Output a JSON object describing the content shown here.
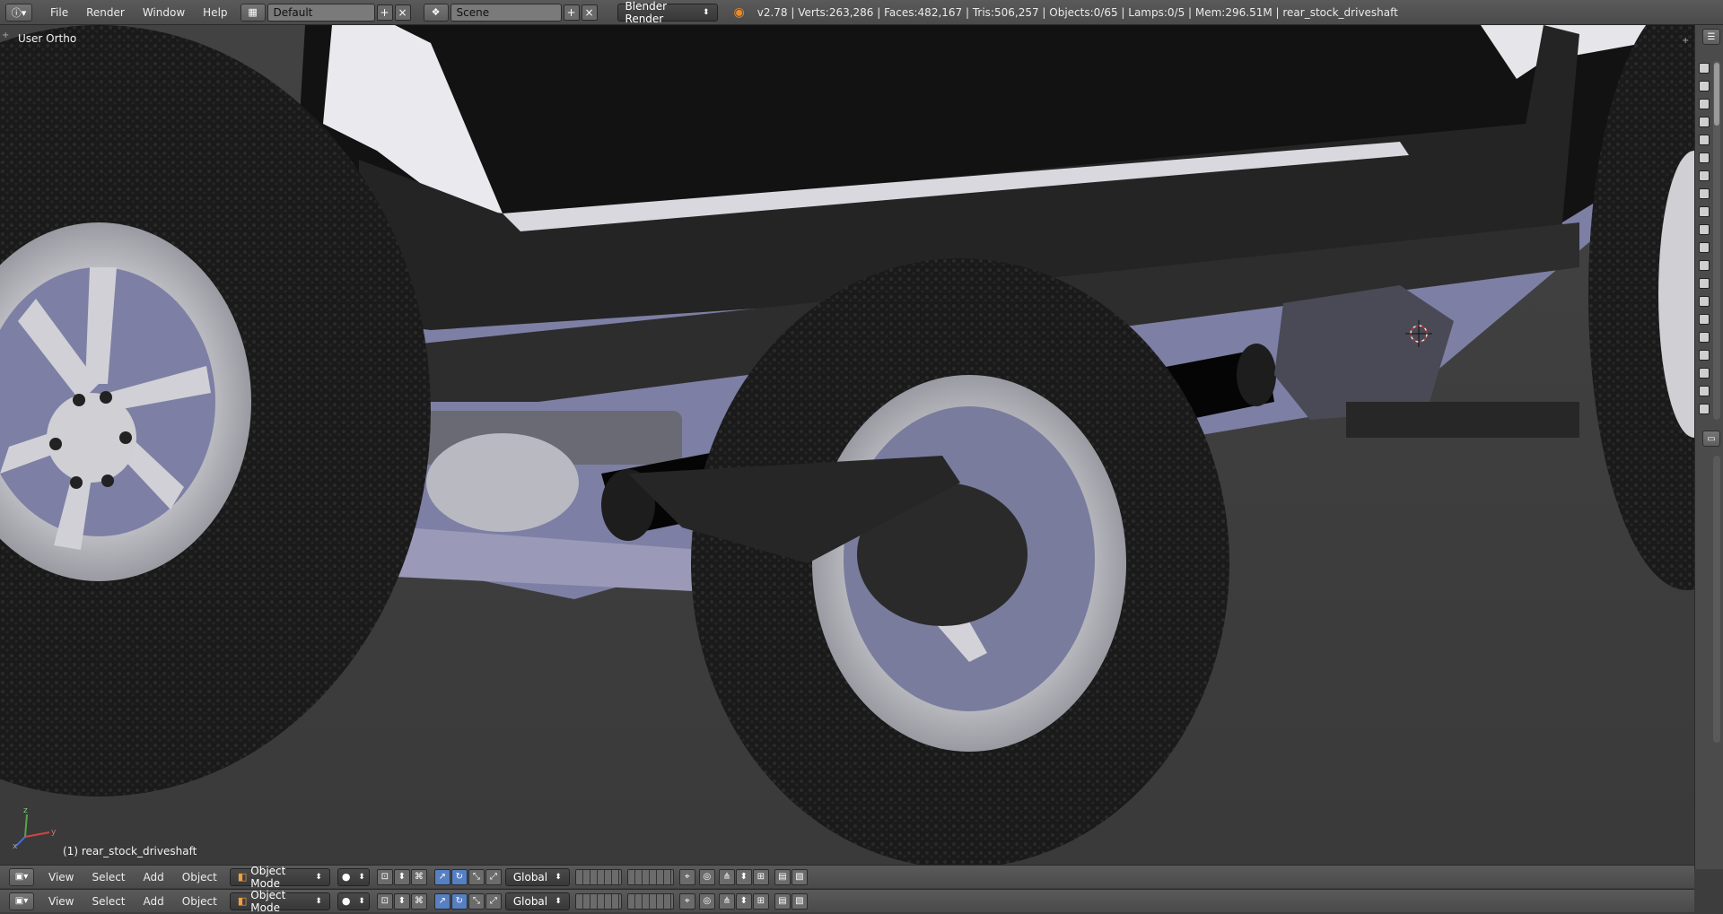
{
  "topbar": {
    "menus": [
      "File",
      "Render",
      "Window",
      "Help"
    ],
    "layout_value": "Default",
    "scene_value": "Scene",
    "engine_value": "Blender Render",
    "stats": "v2.78 | Verts:263,286 | Faces:482,167 | Tris:506,257 | Objects:0/65 | Lamps:0/5 | Mem:296.51M | rear_stock_driveshaft"
  },
  "viewport": {
    "view_name": "User Ortho",
    "object_label": "(1) rear_stock_driveshaft"
  },
  "footer": {
    "menus": [
      "View",
      "Select",
      "Add",
      "Object"
    ],
    "mode": "Object Mode",
    "orientation": "Global"
  },
  "colors": {
    "header_bg": "#4d4d4d",
    "viewport_bg": "#3b3b3b",
    "tire": "#1c1c1c",
    "rim": "#cfcfd3",
    "body_dark": "#222222",
    "body_light": "#e6e6ea",
    "blue_shade": "#7e80a8"
  }
}
